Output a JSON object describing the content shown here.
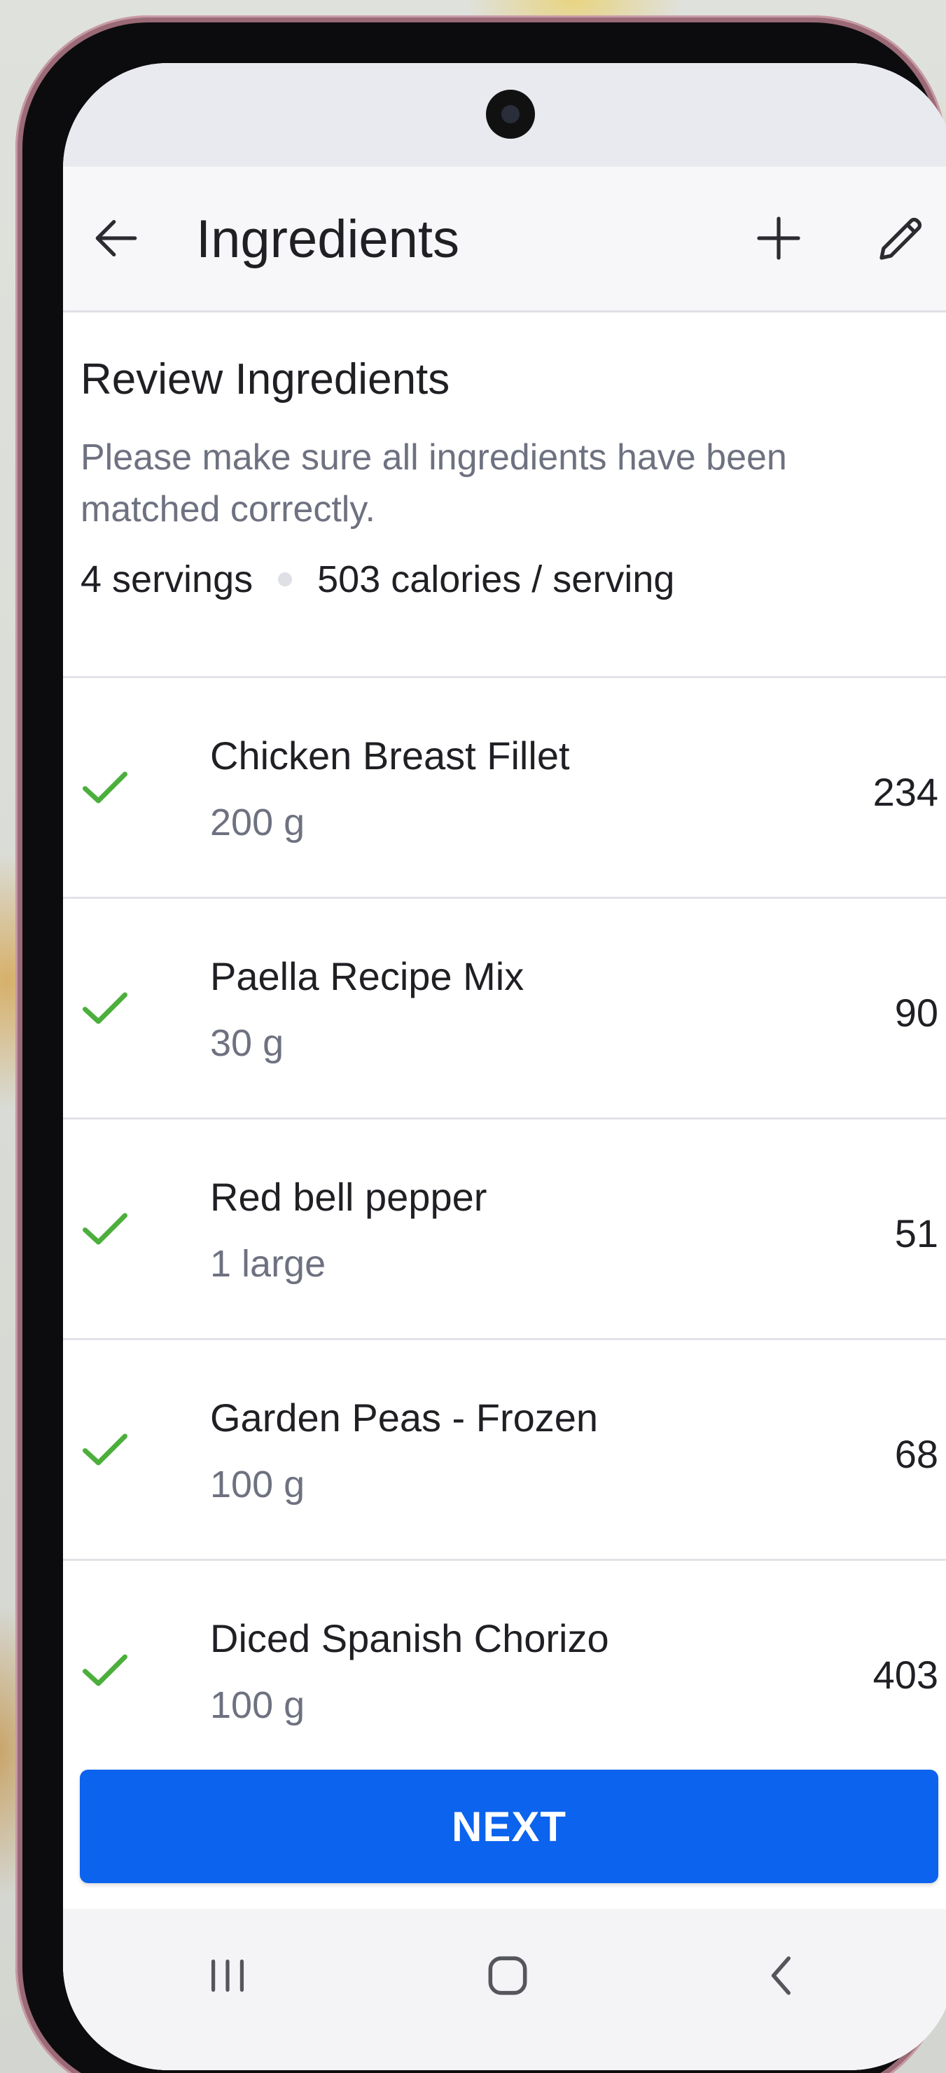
{
  "app_bar": {
    "title": "Ingredients"
  },
  "header": {
    "review_title": "Review Ingredients",
    "description": "Please make sure all ingredients have been matched correctly.",
    "servings": "4 servings",
    "calories": "503 calories / serving"
  },
  "ingredients": [
    {
      "name": "Chicken Breast Fillet",
      "quantity": "200 g",
      "calories": "234"
    },
    {
      "name": "Paella Recipe Mix",
      "quantity": "30 g",
      "calories": "90"
    },
    {
      "name": "Red bell pepper",
      "quantity": "1 large",
      "calories": "51"
    },
    {
      "name": "Garden Peas - Frozen",
      "quantity": "100 g",
      "calories": "68"
    },
    {
      "name": "Diced Spanish Chorizo",
      "quantity": "100 g",
      "calories": "403"
    }
  ],
  "actions": {
    "next_label": "NEXT"
  },
  "icons": {
    "back": "arrow-left-icon",
    "add": "plus-icon",
    "edit": "pencil-icon",
    "matched": "check-icon",
    "nav_recents": "recents-icon",
    "nav_home": "home-icon",
    "nav_back": "chevron-left-icon"
  },
  "colors": {
    "accent": "#0b63ee",
    "check": "#4caf3c",
    "secondary_text": "#6e7180"
  }
}
